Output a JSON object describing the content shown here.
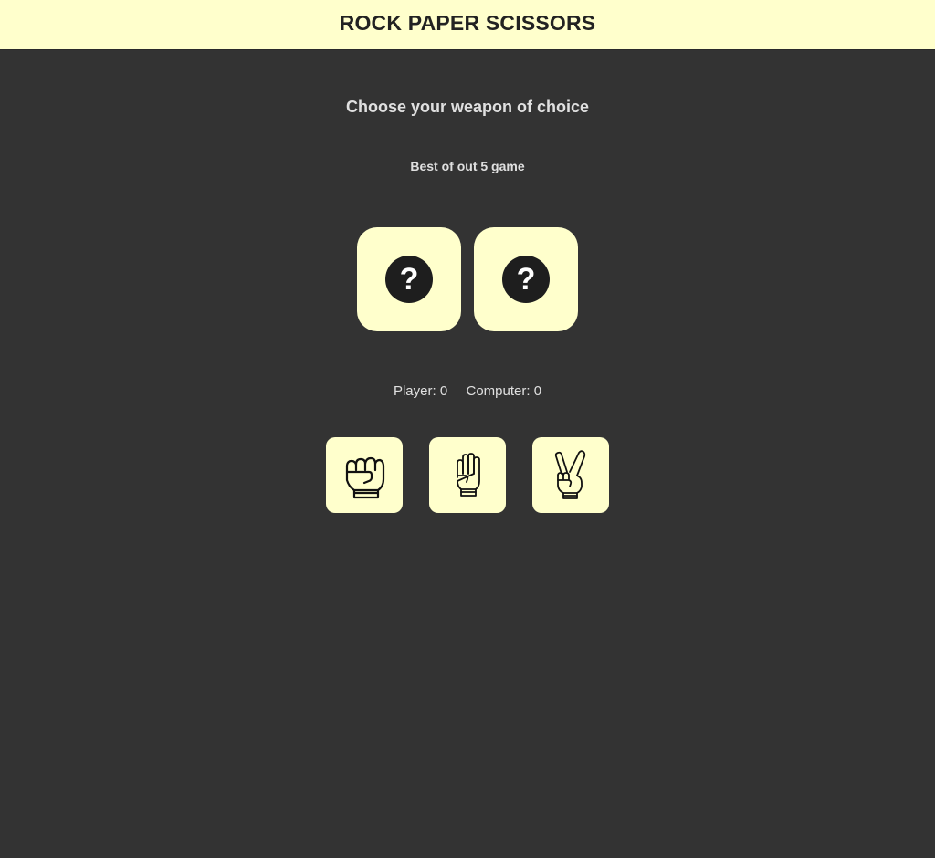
{
  "header": {
    "title": "ROCK PAPER SCISSORS"
  },
  "main": {
    "prompt": "Choose your weapon of choice",
    "subtitle": "Best of out 5 game",
    "player_choice": "?",
    "computer_choice": "?",
    "score": {
      "player_label": "Player:",
      "player_value": "0",
      "computer_label": "Computer:",
      "computer_value": "0"
    },
    "weapons": [
      {
        "name": "rock",
        "icon": "fist-icon"
      },
      {
        "name": "paper",
        "icon": "open-hand-icon"
      },
      {
        "name": "scissors",
        "icon": "peace-hand-icon"
      }
    ]
  },
  "colors": {
    "background": "#333333",
    "card": "#ffffcc",
    "badge": "#1e1e1e"
  }
}
